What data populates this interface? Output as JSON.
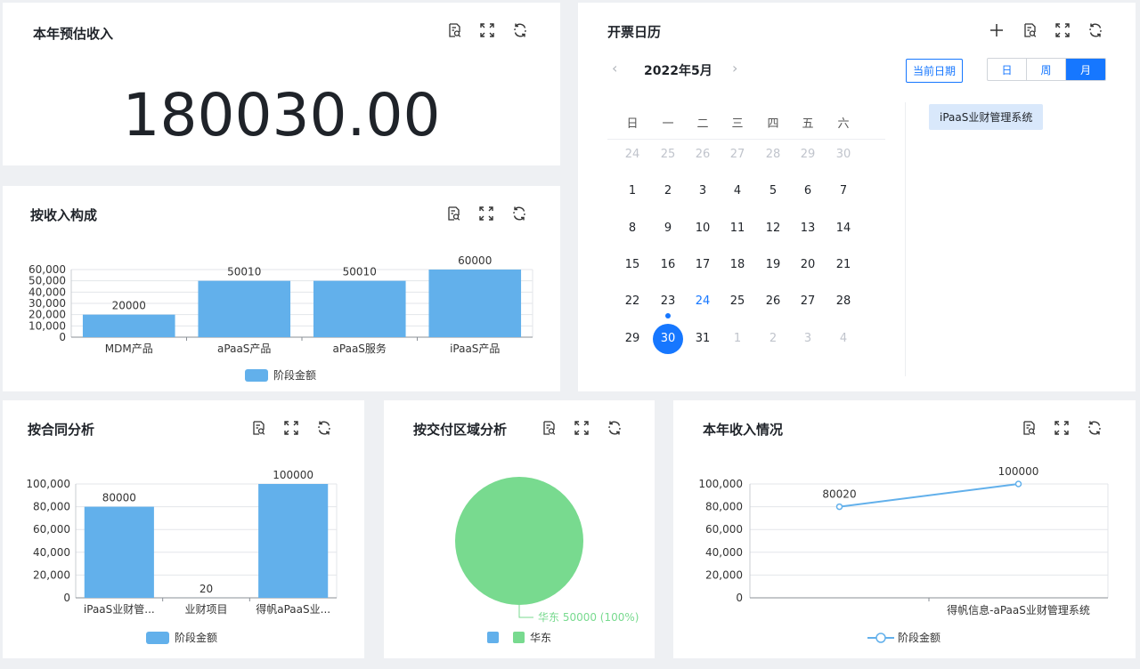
{
  "colors": {
    "bar": "#62b0eb",
    "pie": "#78da8f",
    "accent": "#1677ff",
    "line": "#62b0eb"
  },
  "icons": [
    "search-doc-icon",
    "fullscreen-icon",
    "refresh-icon",
    "plus-icon"
  ],
  "estimate": {
    "title": "本年预估收入",
    "value": "180030.00"
  },
  "income_composition": {
    "title": "按收入构成",
    "legend": "阶段金额",
    "chart_data": {
      "type": "bar",
      "categories": [
        "MDM产品",
        "aPaaS产品",
        "aPaaS服务",
        "iPaaS产品"
      ],
      "values": [
        20000,
        50010,
        50010,
        60000
      ],
      "yticks": [
        "0",
        "10,000",
        "20,000",
        "30,000",
        "40,000",
        "50,000",
        "60,000"
      ],
      "ylim": [
        0,
        60000
      ],
      "series": [
        {
          "name": "阶段金额",
          "values": [
            20000,
            50010,
            50010,
            60000
          ]
        }
      ]
    }
  },
  "contract": {
    "title": "按合同分析",
    "legend": "阶段金额",
    "chart_data": {
      "type": "bar",
      "categories": [
        "iPaaS业财管...",
        "业财项目",
        "得帆aPaaS业..."
      ],
      "values": [
        80000,
        20,
        100000
      ],
      "yticks": [
        "0",
        "20,000",
        "40,000",
        "60,000",
        "80,000",
        "100,000"
      ],
      "ylim": [
        0,
        100000
      ],
      "series": [
        {
          "name": "阶段金额",
          "values": [
            80000,
            20,
            100000
          ]
        }
      ]
    }
  },
  "region": {
    "title": "按交付区域分析",
    "legend": [
      "",
      "华东"
    ],
    "chart_data": {
      "type": "pie",
      "slices": [
        {
          "name": "华东",
          "value": 50000,
          "percent": 100
        }
      ],
      "label": "华东 50000 (100%)"
    }
  },
  "yearly": {
    "title": "本年收入情况",
    "legend": "阶段金额",
    "chart_data": {
      "type": "line",
      "x": [
        "",
        "得帆信息-aPaaS业财管理系统"
      ],
      "values": [
        80020,
        100000
      ],
      "yticks": [
        "0",
        "20,000",
        "40,000",
        "60,000",
        "80,000",
        "100,000"
      ],
      "ylim": [
        0,
        100000
      ],
      "series": [
        {
          "name": "阶段金额",
          "values": [
            80020,
            100000
          ]
        }
      ]
    }
  },
  "calendar": {
    "title": "开票日历",
    "month_label": "2022年5月",
    "today_button": "当前日期",
    "views": [
      "日",
      "周",
      "月"
    ],
    "active_view": "月",
    "weekdays": [
      "日",
      "一",
      "二",
      "三",
      "四",
      "五",
      "六"
    ],
    "weeks": [
      [
        "24",
        "25",
        "26",
        "27",
        "28",
        "29",
        "30"
      ],
      [
        "1",
        "2",
        "3",
        "4",
        "5",
        "6",
        "7"
      ],
      [
        "8",
        "9",
        "10",
        "11",
        "12",
        "13",
        "14"
      ],
      [
        "15",
        "16",
        "17",
        "18",
        "19",
        "20",
        "21"
      ],
      [
        "22",
        "23",
        "24",
        "25",
        "26",
        "27",
        "28"
      ],
      [
        "29",
        "30",
        "31",
        "1",
        "2",
        "3",
        "4"
      ]
    ],
    "event": "iPaaS业财管理系统"
  }
}
